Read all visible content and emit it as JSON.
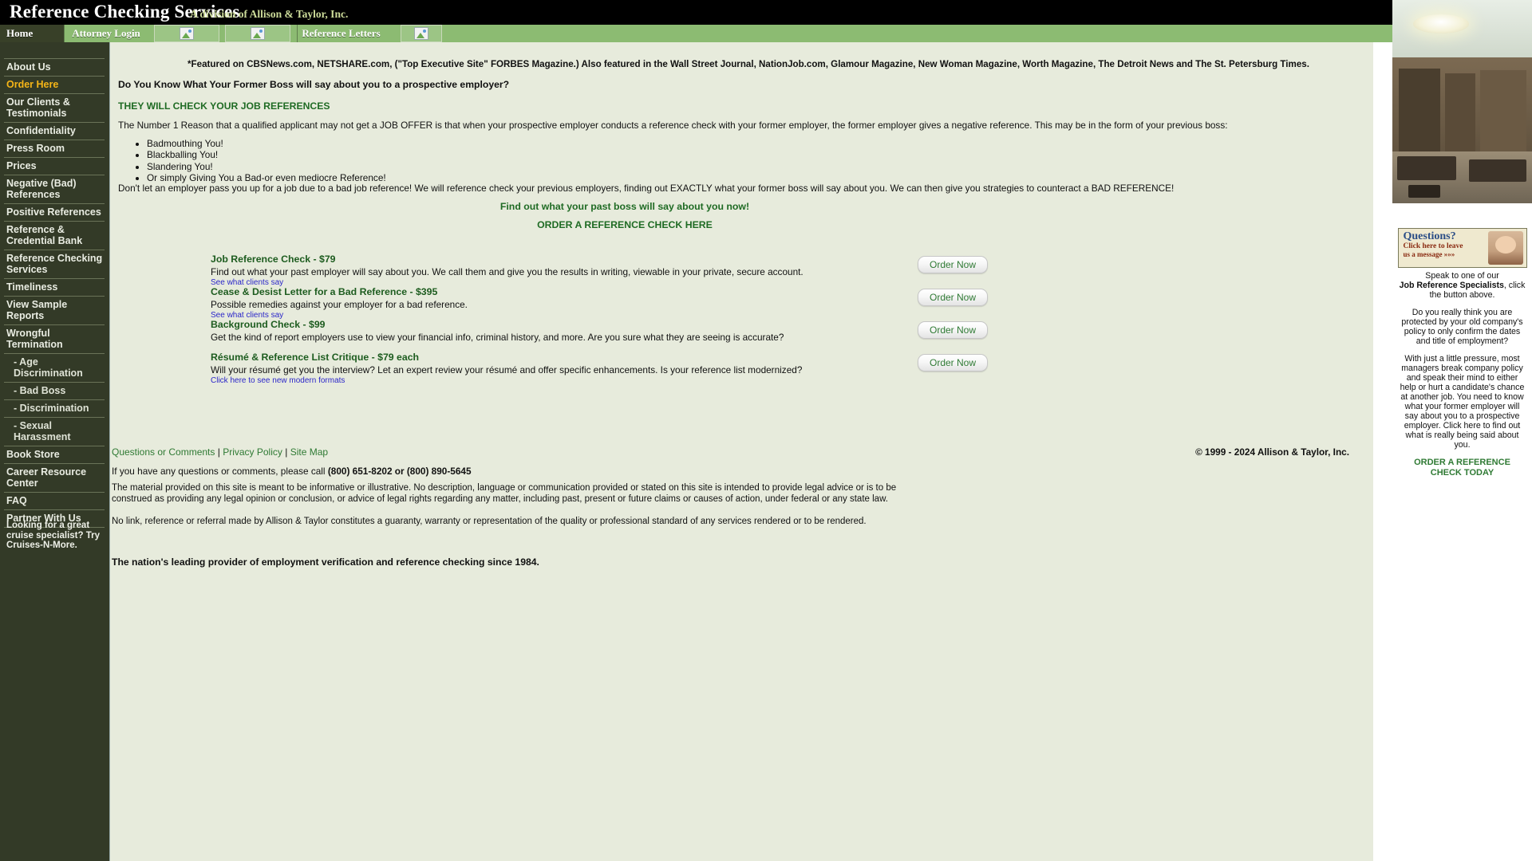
{
  "masthead": {
    "title": "Reference Checking Services",
    "subtitle": "A division of Allison & Taylor, Inc."
  },
  "tabs": [
    {
      "label": "Home",
      "icon": ""
    },
    {
      "label": "Attorney Login",
      "icon": ""
    },
    {
      "label": "",
      "icon": "broken-image-icon"
    },
    {
      "label": "",
      "icon": "broken-image-icon"
    },
    {
      "label": "Reference Letters",
      "icon": ""
    },
    {
      "label": "",
      "icon": "broken-image-icon"
    }
  ],
  "sidebar": {
    "items": [
      {
        "label": "About Us",
        "active": false,
        "sub": false
      },
      {
        "label": "Order Here",
        "active": true,
        "sub": false
      },
      {
        "label": "Our Clients & Testimonials",
        "active": false,
        "sub": false
      },
      {
        "label": "Confidentiality",
        "active": false,
        "sub": false
      },
      {
        "label": "Press Room",
        "active": false,
        "sub": false
      },
      {
        "label": "Prices",
        "active": false,
        "sub": false
      },
      {
        "label": "Negative (Bad) References",
        "active": false,
        "sub": false
      },
      {
        "label": "Positive References",
        "active": false,
        "sub": false
      },
      {
        "label": "Reference & Credential Bank",
        "active": false,
        "sub": false
      },
      {
        "label": "Reference Checking Services",
        "active": false,
        "sub": false
      },
      {
        "label": "Timeliness",
        "active": false,
        "sub": false
      },
      {
        "label": "View Sample Reports",
        "active": false,
        "sub": false
      },
      {
        "label": "Wrongful Termination",
        "active": false,
        "sub": false
      },
      {
        "label": "- Age Discrimination",
        "active": false,
        "sub": true
      },
      {
        "label": "- Bad Boss",
        "active": false,
        "sub": true
      },
      {
        "label": "- Discrimination",
        "active": false,
        "sub": true
      },
      {
        "label": "- Sexual Harassment",
        "active": false,
        "sub": true
      },
      {
        "label": "Book Store",
        "active": false,
        "sub": false
      },
      {
        "label": "Career Resource Center",
        "active": false,
        "sub": false
      },
      {
        "label": "FAQ",
        "active": false,
        "sub": false
      },
      {
        "label": "Partner With Us",
        "active": false,
        "sub": false
      }
    ],
    "cruise_ad": "Looking for a great cruise specialist? Try Cruises-N-More."
  },
  "main": {
    "feature_line": "*Featured on CBSNews.com, NETSHARE.com, (\"Top Executive Site\" FORBES Magazine.) Also featured in the Wall Street Journal, NationJob.com, Glamour Magazine, New Woman Magazine, Worth Magazine, The Detroit News and The St. Petersburg Times.",
    "lead": "Do You Know What Your Former Boss will say about you to a prospective employer?",
    "will_check": "THEY WILL CHECK YOUR JOB REFERENCES",
    "paragraph_1": "The Number 1 Reason that a qualified applicant may not get a JOB OFFER is that when your prospective employer conducts a reference check with your former employer, the former employer gives a negative reference. This may be in the form of your previous boss:",
    "bullets": [
      "Badmouthing You!",
      "Blackballing You!",
      "Slandering You!",
      "Or simply Giving You a Bad-or even mediocre Reference!"
    ],
    "paragraph_2": "Don't let an employer pass you up for a job due to a bad job reference! We will reference check your previous employers, finding out EXACTLY what your former boss will say about you. We can then give you strategies to counteract a BAD REFERENCE!",
    "find_out": "Find out what your past boss will say about you now!",
    "order_here": "ORDER A REFERENCE CHECK HERE",
    "products": [
      {
        "title": "Job Reference Check - $79",
        "description": "Find out what your past employer will say about you. We call them and give you the results in writing, viewable in your private, secure account.",
        "link": "See what clients say",
        "button": "Order Now"
      },
      {
        "title": "Cease & Desist Letter for a Bad Reference - $395",
        "description": "Possible remedies against your employer for a bad reference.",
        "link": "See what clients say",
        "button": "Order Now"
      },
      {
        "title": "Background Check - $99",
        "description": "Get the kind of report employers use to view your financial info, criminal history, and more. Are you sure what they are seeing is accurate?",
        "link": "",
        "button": "Order Now"
      },
      {
        "title": "Résumé & Reference List Critique - $79 each",
        "description": "Will your résumé get you the interview? Let an expert review your résumé and offer specific enhancements. Is your reference list modernized?",
        "link": "Click here to see new modern formats",
        "button": "Order Now"
      }
    ]
  },
  "footer": {
    "links": [
      "Questions or Comments",
      "Privacy Policy",
      "Site Map"
    ],
    "separator": "|",
    "copyright": "© 1999 - 2024 Allison & Taylor, Inc.",
    "call_prefix": "If you have any questions or comments, please call ",
    "phone": "(800) 651-8202 or (800) 890-5645",
    "legal_1": "The material provided on this site is meant to be informative or illustrative. No description, language or communication provided or stated on this site is intended to provide legal advice or is to be construed as providing any legal opinion or conclusion, or advice of legal rights regarding any matter, including past, present or future claims or causes of action, under federal or any state law.",
    "legal_2": "No link, reference or referral made by Allison & Taylor constitutes a guaranty, warranty or representation of the quality or professional standard of any services rendered or to be rendered.",
    "tagline": "The nation's leading provider of employment verification and reference checking since 1984."
  },
  "promo": {
    "badge_line_1": "Questions?",
    "badge_line_2": "Click here to leave",
    "badge_line_3": "us a message »»»",
    "text_1": "Speak to one of our",
    "text_bold": "Job Reference Specialists",
    "text_2": ", click the button above.",
    "paragraph_1": "Do you really think you are protected by your old company's policy to only confirm the dates and title of employment?",
    "paragraph_2": "With just a little pressure, most managers break company policy and speak their mind to either help or hurt a candidate's chance at another job. You need to know what your former employer will say about you to a prospective employer. Click here to find out what is really being said about you.",
    "cta": "ORDER A REFERENCE CHECK TODAY"
  }
}
